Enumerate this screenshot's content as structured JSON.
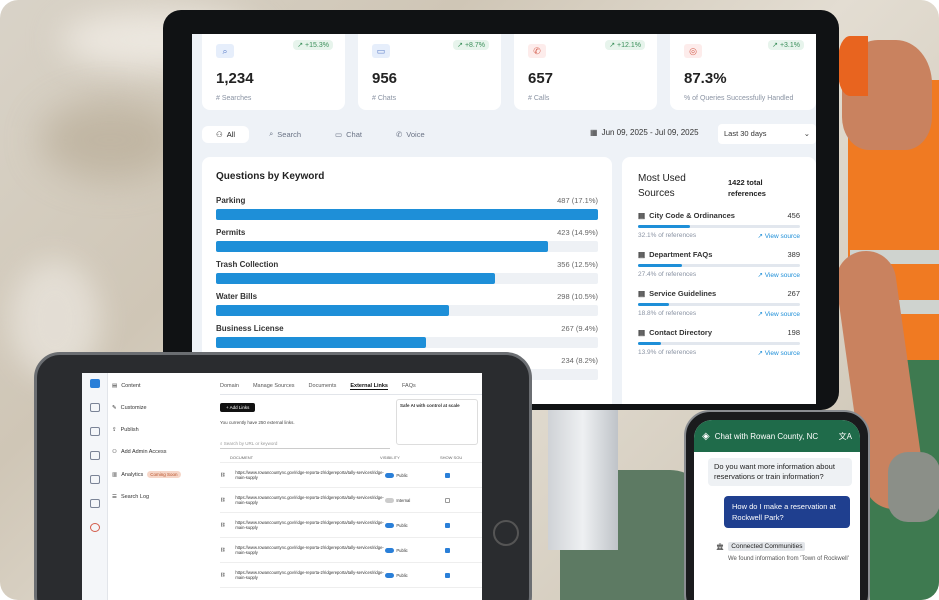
{
  "stats": [
    {
      "icon": "search-icon",
      "delta": "↗ +15.3%",
      "value": "1,234",
      "label": "# Searches"
    },
    {
      "icon": "chat-icon",
      "delta": "↗ +8.7%",
      "value": "956",
      "label": "# Chats"
    },
    {
      "icon": "phone-icon",
      "delta": "↗ +12.1%",
      "value": "657",
      "label": "# Calls"
    },
    {
      "icon": "check-circle-icon",
      "delta": "↗ +3.1%",
      "value": "87.3%",
      "label": "% of Queries Successfully Handled"
    }
  ],
  "filters": {
    "all": "All",
    "search": "Search",
    "chat": "Chat",
    "voice": "Voice"
  },
  "daterange": "Jun 09, 2025 - Jul 09, 2025",
  "period": "Last 30 days",
  "keywords": {
    "title": "Questions by Keyword",
    "items": [
      {
        "label": "Parking",
        "count": "487",
        "pct": "(17.1%)",
        "fill": 1.0
      },
      {
        "label": "Permits",
        "count": "423",
        "pct": "(14.9%)",
        "fill": 0.87
      },
      {
        "label": "Trash Collection",
        "count": "356",
        "pct": "(12.5%)",
        "fill": 0.73
      },
      {
        "label": "Water Bills",
        "count": "298",
        "pct": "(10.5%)",
        "fill": 0.61
      },
      {
        "label": "Business License",
        "count": "267",
        "pct": "(9.4%)",
        "fill": 0.55
      },
      {
        "label": "",
        "count": "234",
        "pct": "(8.2%)",
        "fill": 0.48
      }
    ]
  },
  "sources": {
    "title": "Most Used Sources",
    "total": "1422 total references",
    "link_label": "↗ View source",
    "items": [
      {
        "name": "City Code & Ordinances",
        "count": "456",
        "pct": "32.1% of references",
        "fill": 0.32
      },
      {
        "name": "Department FAQs",
        "count": "389",
        "pct": "27.4% of references",
        "fill": 0.27
      },
      {
        "name": "Service Guidelines",
        "count": "267",
        "pct": "18.8% of references",
        "fill": 0.19
      },
      {
        "name": "Contact Directory",
        "count": "198",
        "pct": "13.9% of references",
        "fill": 0.14
      }
    ]
  },
  "tablet": {
    "nav": [
      {
        "label": "Content"
      },
      {
        "label": "Customize"
      },
      {
        "label": "Publish"
      },
      {
        "label": "Add Admin Access"
      },
      {
        "label": "Analytics",
        "badge": "Coming Soon"
      },
      {
        "label": "Search Log"
      }
    ],
    "tabs": [
      "Domain",
      "Manage Sources",
      "Documents",
      "External Links",
      "FAQs"
    ],
    "add_button": "+ Add Links",
    "desc": "You currently have 250 external links.",
    "callout": "Safe AI with control at scale",
    "search_placeholder": "Search by URL or keyword",
    "col_url": "DOCUMENT",
    "col_vis": "VISIBILITY",
    "col_show": "SHOW SOU",
    "rows": [
      {
        "url": "https://www.rowancountync.gov/ridge-reporta-2/ridgereporta/tally-services/ridge-main-supply",
        "vis": "Public",
        "on": true,
        "show": true
      },
      {
        "url": "https://www.rowancountync.gov/ridge-reporta-2/ridgereporta/tally-services/ridge-main-supply",
        "vis": "Internal",
        "on": false,
        "show": false
      },
      {
        "url": "https://www.rowancountync.gov/ridge-reporta-2/ridgereporta/tally-services/ridge-main-supply",
        "vis": "Public",
        "on": true,
        "show": true
      },
      {
        "url": "https://www.rowancountync.gov/ridge-reporta-2/ridgereporta/tally-services/ridge-main-supply",
        "vis": "Public",
        "on": true,
        "show": true
      },
      {
        "url": "https://www.rowancountync.gov/ridge-reporta-2/ridgereporta/tally-services/ridge-main-supply",
        "vis": "Public",
        "on": true,
        "show": true
      }
    ]
  },
  "phone": {
    "title": "Chat with Rowan County, NC",
    "bot_msg": "Do you want more information about reservations or train information?",
    "user_msg": "How do I make a reservation at Rockwell Park?",
    "cc_label": "Connected Communities",
    "found": "We found information from 'Town of Rockwell'"
  }
}
